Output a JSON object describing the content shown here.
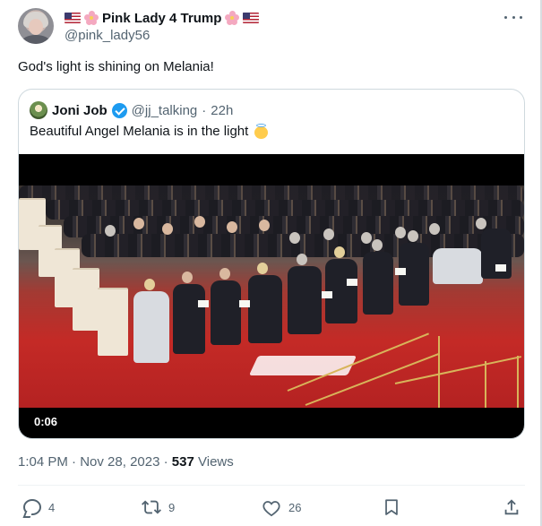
{
  "author": {
    "display_name": "Pink Lady 4 Trump",
    "handle": "@pink_lady56",
    "name_prefix_icons": [
      "us-flag-icon",
      "cherry-blossom-icon"
    ],
    "name_suffix_icons": [
      "cherry-blossom-icon",
      "us-flag-icon"
    ]
  },
  "tweet": {
    "text": "God's light is shining on Melania!"
  },
  "quoted_tweet": {
    "display_name": "Joni Job",
    "handle": "@jj_talking",
    "separator": "·",
    "time": "22h",
    "text": "Beautiful Angel Melania is in the light",
    "emoji_icon": "angel-icon",
    "video": {
      "duration": "0:06"
    }
  },
  "meta": {
    "time": "1:04 PM",
    "separator1": "·",
    "date": "Nov 28, 2023",
    "separator2": "·",
    "views_count": "537",
    "views_label": "Views"
  },
  "actions": {
    "reply_count": "4",
    "retweet_count": "9",
    "like_count": "26"
  },
  "colors": {
    "text_primary": "#0f1419",
    "text_secondary": "#536471",
    "border": "#cfd9de",
    "verified_blue": "#1d9bf0"
  }
}
